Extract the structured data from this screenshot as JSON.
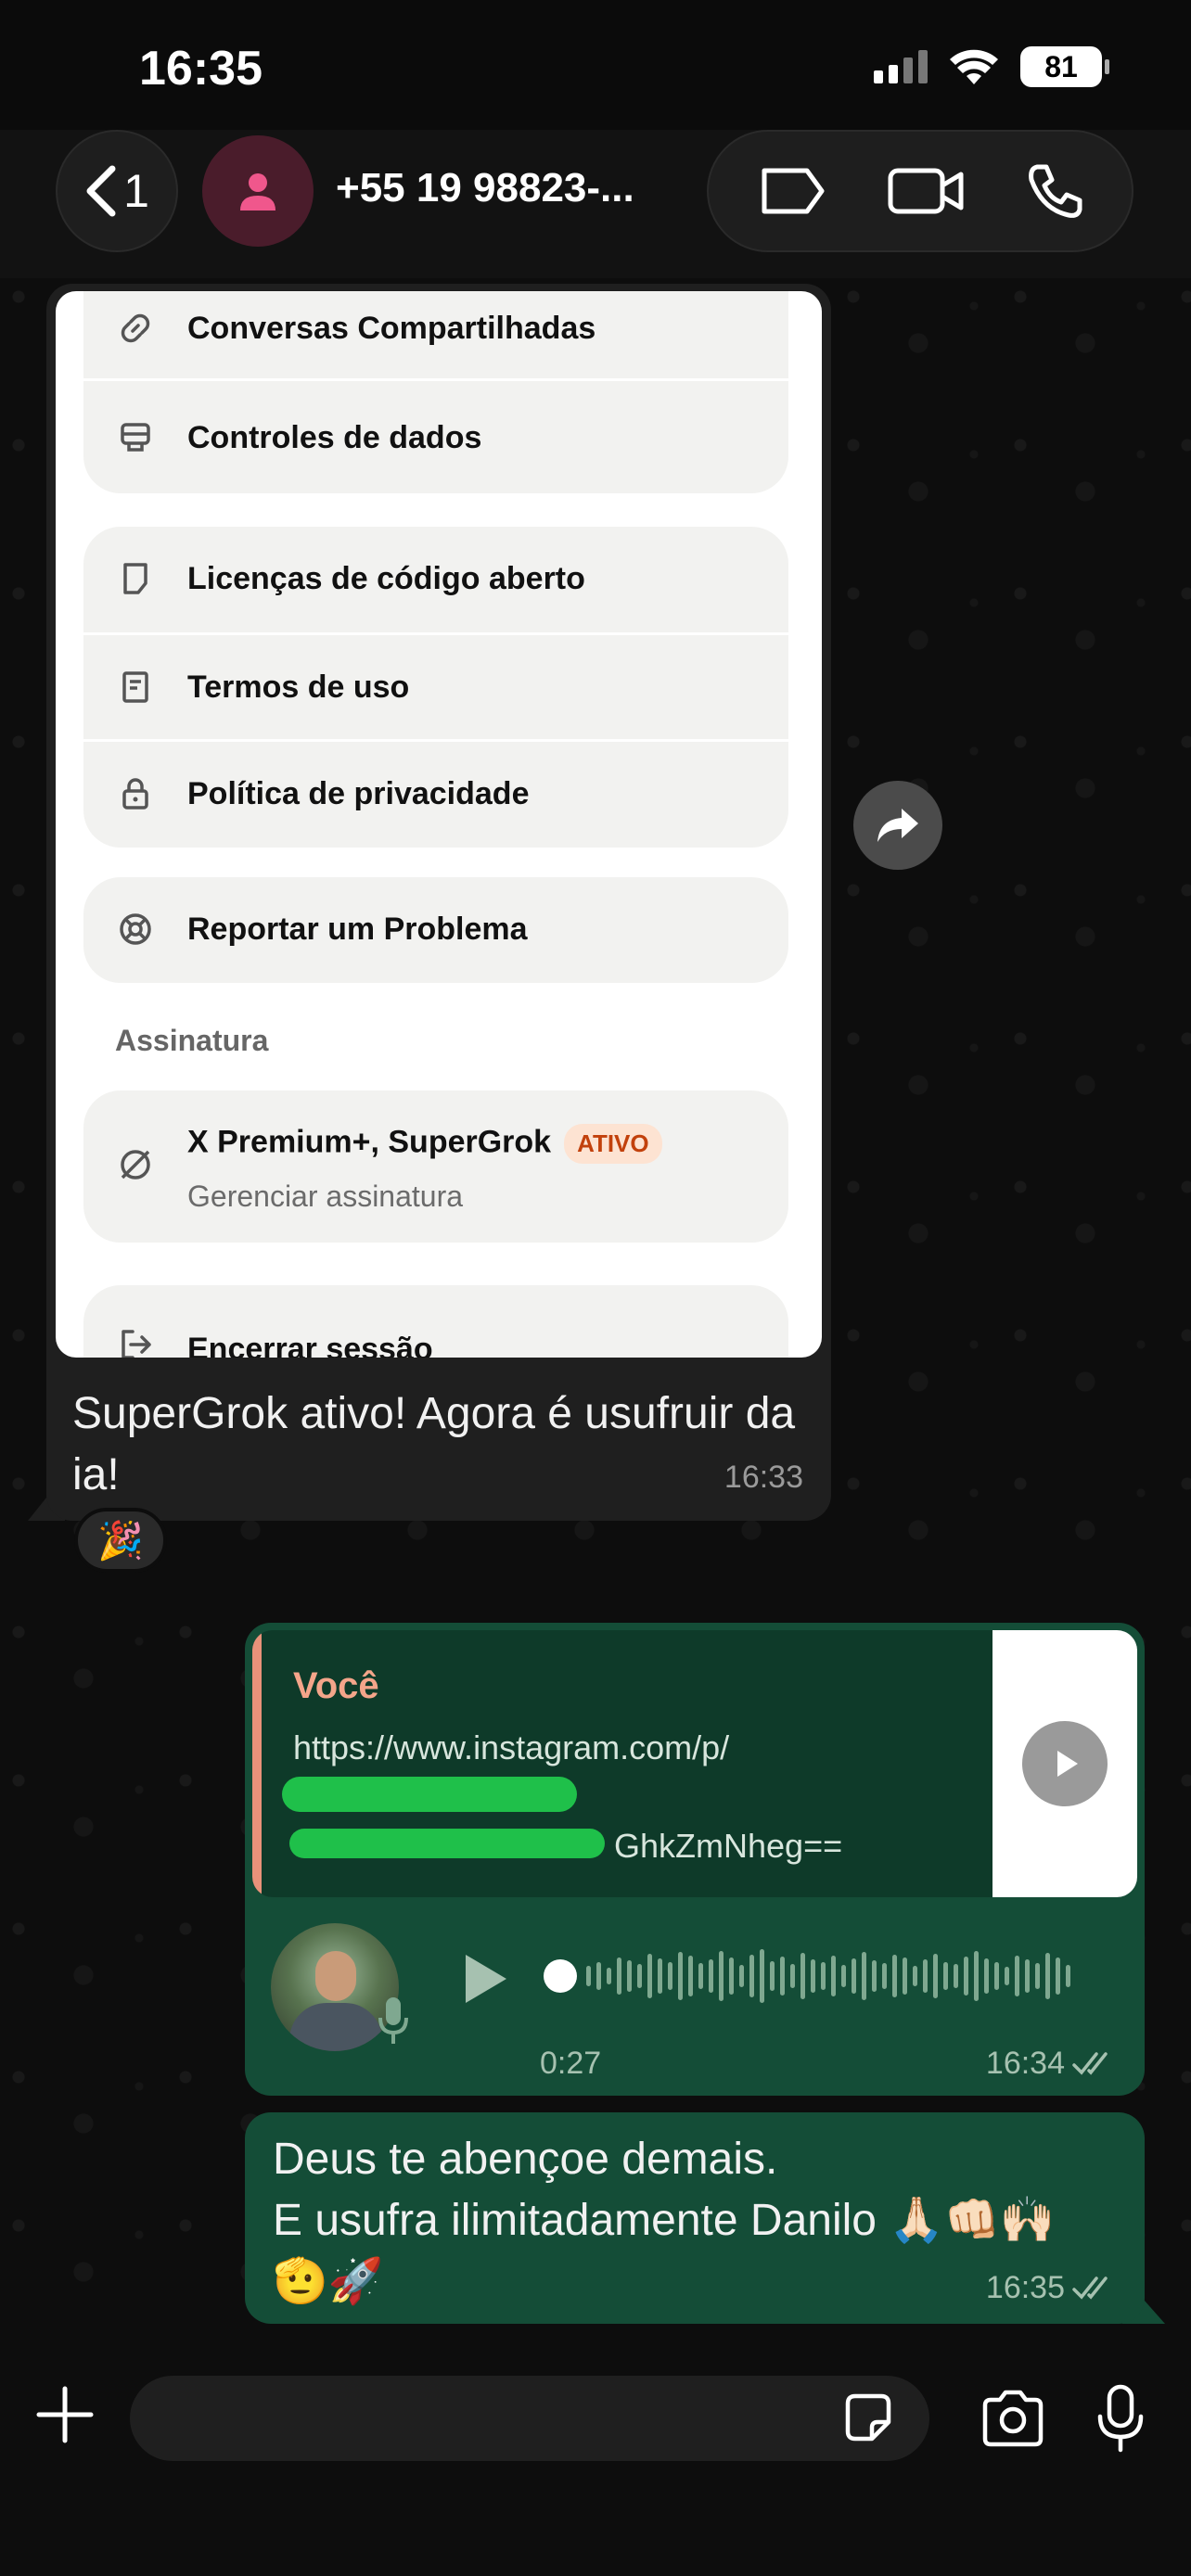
{
  "status_bar": {
    "time": "16:35",
    "battery": "81"
  },
  "header": {
    "back_count": "1",
    "contact_name": "+55 19 98823-...",
    "icons": [
      "back-chevron-icon",
      "person-icon",
      "label-icon",
      "video-call-icon",
      "phone-icon"
    ]
  },
  "incoming_message": {
    "screenshot_menu": {
      "group1": [
        "Conversas Compartilhadas",
        "Controles de dados"
      ],
      "group2": [
        "Licenças de código aberto",
        "Termos de uso",
        "Política de privacidade"
      ],
      "group3": [
        "Reportar um Problema"
      ],
      "section_label": "Assinatura",
      "subscription_title": "X Premium+, SuperGrok",
      "subscription_badge": "ATIVO",
      "subscription_subtitle": "Gerenciar assinatura",
      "logout": "Encerrar sessão"
    },
    "text": "SuperGrok ativo! Agora é usufruir da ia!",
    "time": "16:33",
    "reaction": "🎉"
  },
  "outgoing_voice": {
    "quote_author": "Você",
    "quote_text_line1": "https://www.instagram.com/p/",
    "quote_text_line3": "GhkZmNheg==",
    "duration": "0:27",
    "time": "16:34"
  },
  "outgoing_text": {
    "text": "Deus te abençoe demais.\nE usufra ilimitadamente Danilo 🙏🏻👊🏻🙌🏻\n🫡🚀",
    "time": "16:35"
  },
  "input_bar": {
    "placeholder": ""
  },
  "colors": {
    "out_bubble": "#144d37",
    "in_bubble": "#1f1f1f",
    "quote_accent": "#e8927a",
    "badge_text": "#c2410c"
  }
}
